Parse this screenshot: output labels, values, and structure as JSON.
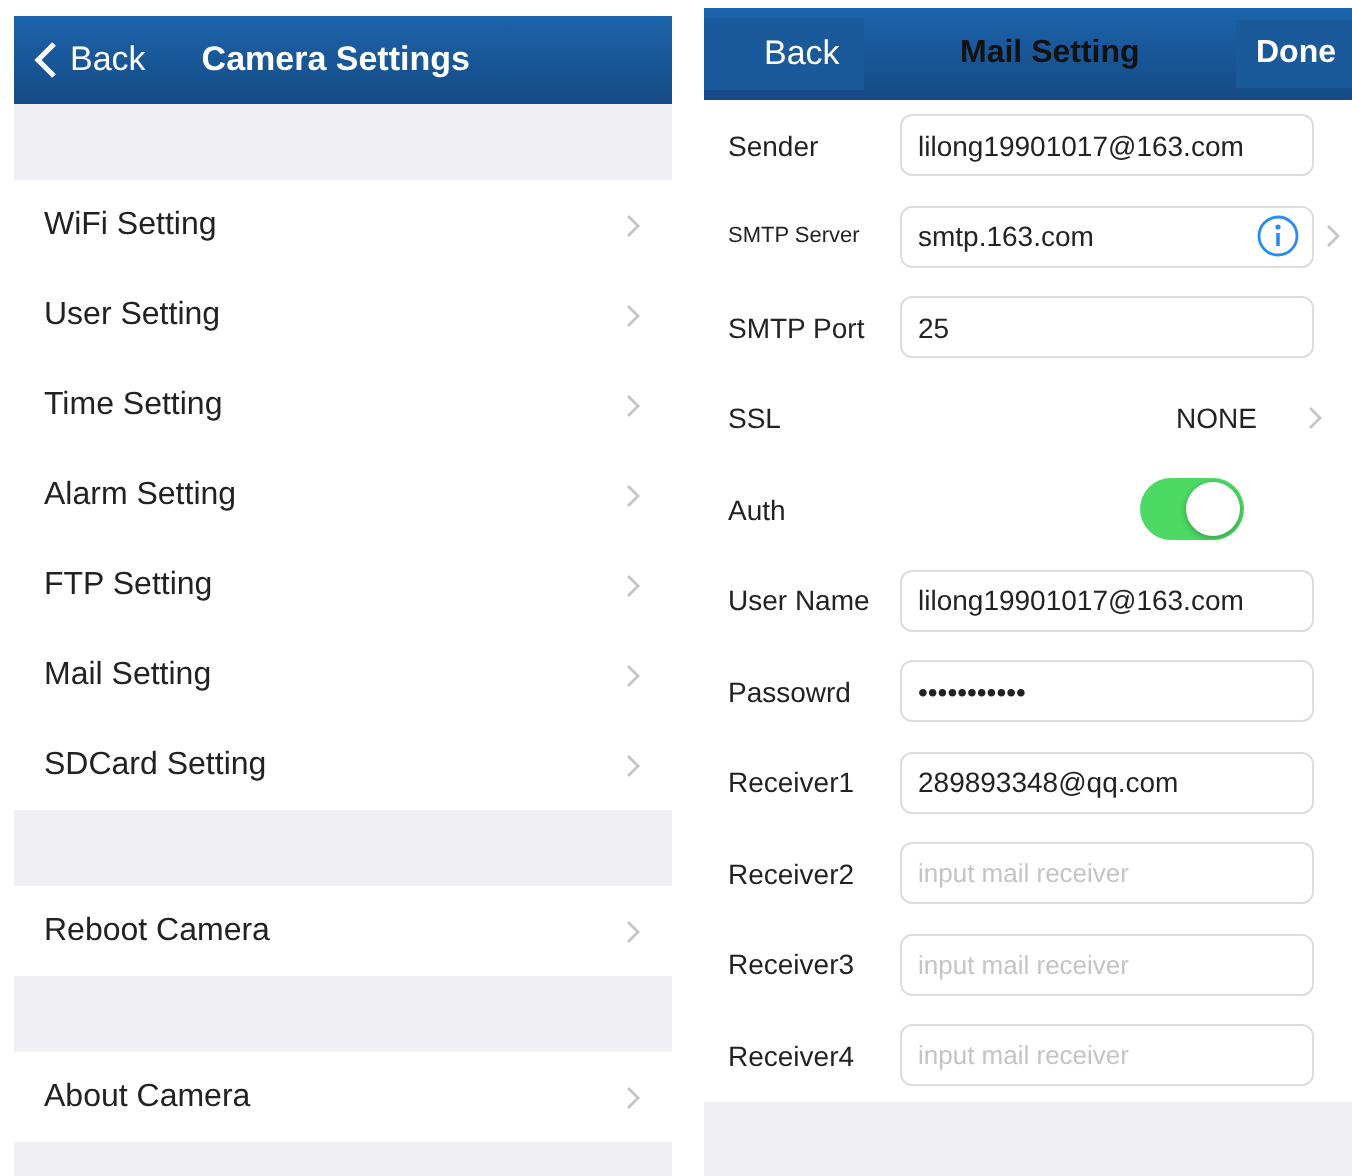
{
  "camera_settings": {
    "back": "Back",
    "title": "Camera Settings",
    "groups": [
      {
        "items": [
          "WiFi Setting",
          "User Setting",
          "Time Setting",
          "Alarm Setting",
          "FTP Setting",
          "Mail Setting",
          "SDCard Setting"
        ]
      },
      {
        "items": [
          "Reboot Camera"
        ]
      },
      {
        "items": [
          "About Camera"
        ]
      }
    ]
  },
  "mail_setting": {
    "back": "Back",
    "title": "Mail Setting",
    "done": "Done",
    "rows": [
      {
        "kind": "field",
        "label": "Sender",
        "value": "lilong19901017@163.com"
      },
      {
        "kind": "info-field",
        "label": "SMTP Server",
        "value": "smtp.163.com"
      },
      {
        "kind": "field",
        "label": "SMTP Port",
        "value": "25"
      },
      {
        "kind": "select",
        "label": "SSL",
        "value": "NONE"
      },
      {
        "kind": "toggle",
        "label": "Auth",
        "on": true
      },
      {
        "kind": "field",
        "label": "User Name",
        "value": "lilong19901017@163.com"
      },
      {
        "kind": "field",
        "label": "Passowrd",
        "value": "•••••••••••"
      },
      {
        "kind": "field",
        "label": "Receiver1",
        "value": "289893348@qq.com"
      },
      {
        "kind": "field",
        "label": "Receiver2",
        "placeholder": "input mail receiver"
      },
      {
        "kind": "field",
        "label": "Receiver3",
        "placeholder": "input mail receiver"
      },
      {
        "kind": "field",
        "label": "Receiver4",
        "placeholder": "input mail receiver"
      }
    ]
  }
}
